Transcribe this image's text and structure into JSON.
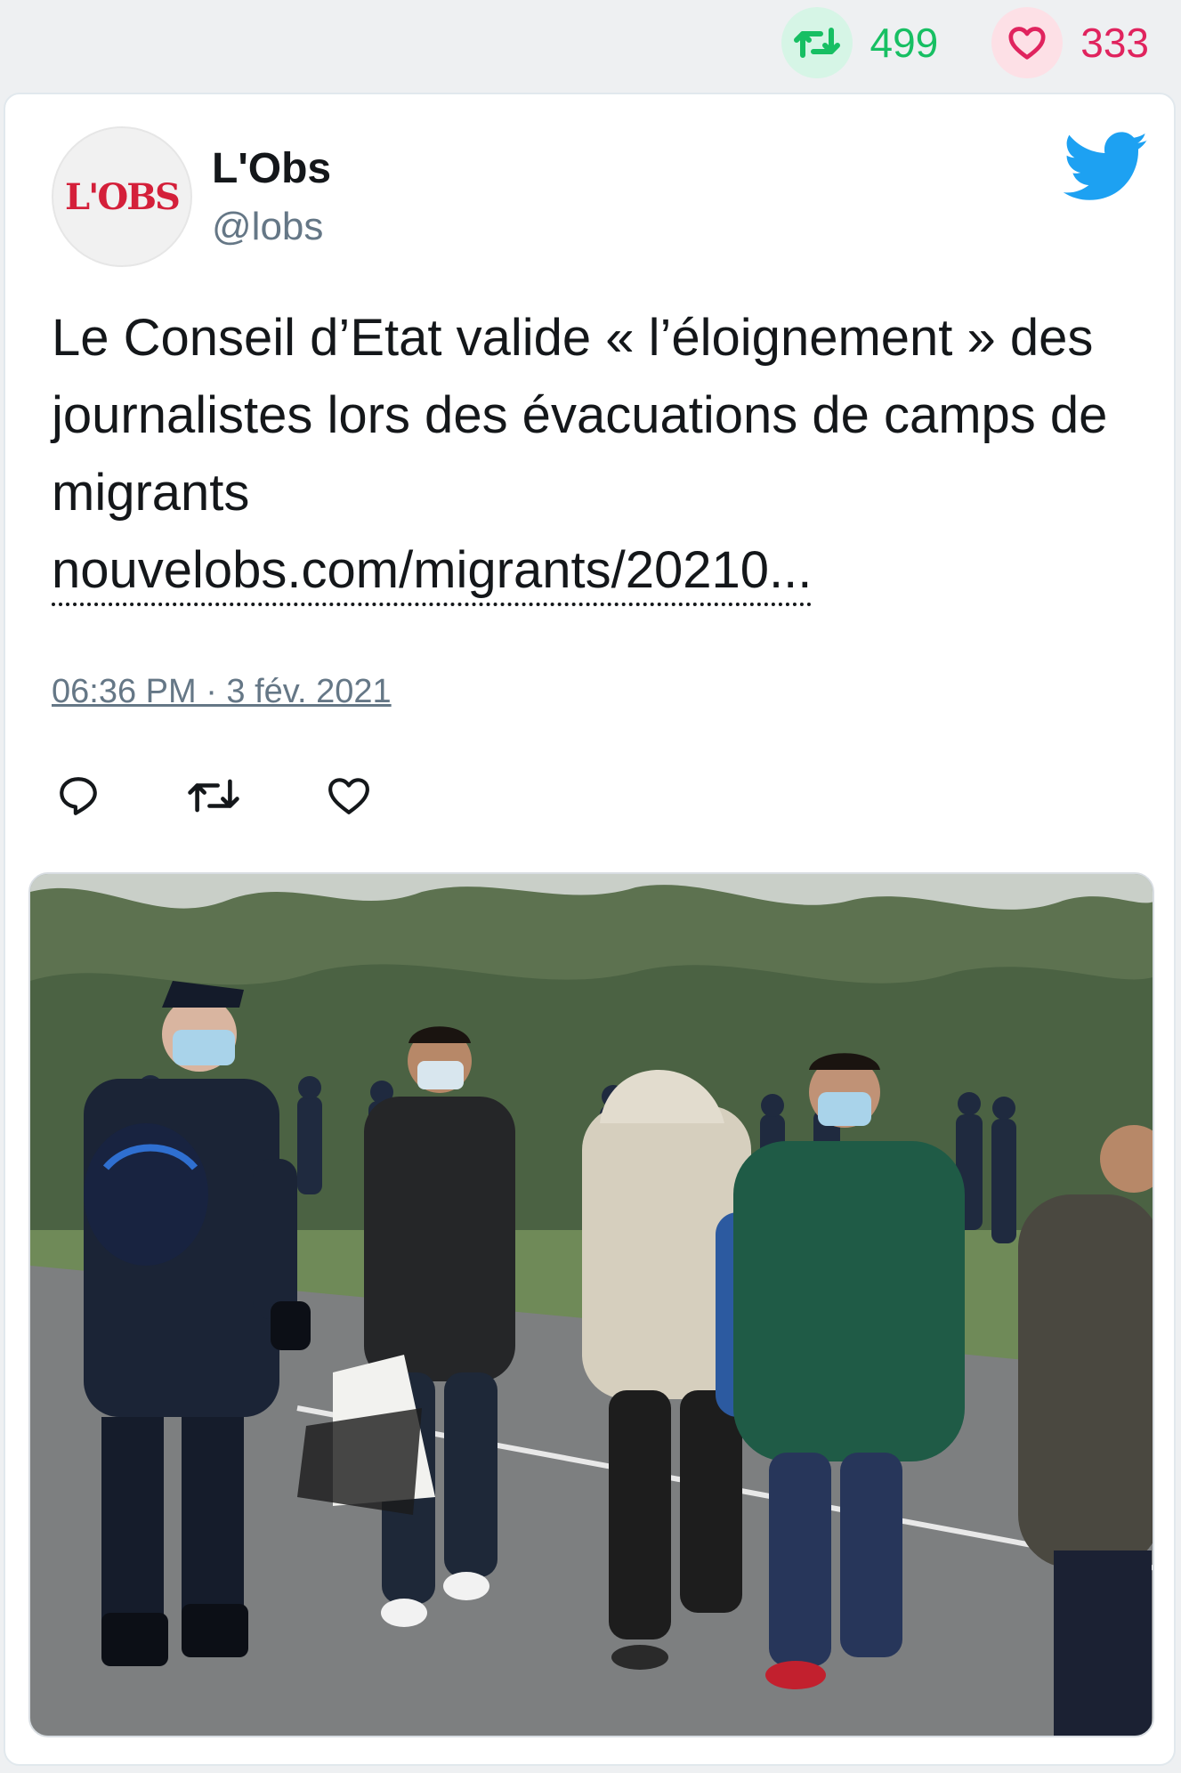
{
  "stats": {
    "retweets": "499",
    "likes": "333"
  },
  "tweet": {
    "display_name": "L'Obs",
    "handle": "@lobs",
    "avatar_text": "L'OBS",
    "text": "Le Conseil d’Etat valide « l’éloignement » des journalistes lors des évacuations de camps de migrants",
    "link": "nouvelobs.com/migrants/20210...",
    "timestamp": "06:36 PM · 3 fév. 2021"
  },
  "icons": {
    "retweet": "retweet-icon",
    "like": "heart-icon",
    "reply": "reply-icon",
    "twitter": "twitter-bird-icon"
  },
  "colors": {
    "retweet": "#17bf63",
    "like": "#e0245e",
    "twitter_blue": "#1da1f2",
    "text": "#14171a",
    "muted": "#657786"
  }
}
